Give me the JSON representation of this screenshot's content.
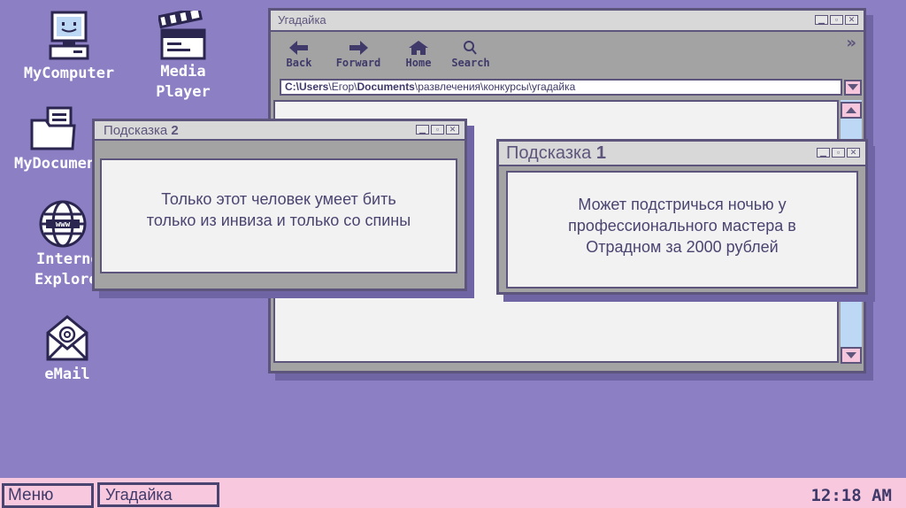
{
  "desktop": {
    "icons": [
      {
        "label": "MyComputer"
      },
      {
        "label_line1": "Media",
        "label_line2": "Player"
      },
      {
        "label": "MyDocuments"
      },
      {
        "label_line1": "Internet",
        "label_line2": "Explorer"
      },
      {
        "label": "eMail"
      }
    ]
  },
  "browser": {
    "title": "Угадайка",
    "toolbar": {
      "back_label": "Back",
      "forward_label": "Forward",
      "home_label": "Home",
      "search_label": "Search"
    },
    "more_glyph": "»",
    "address": {
      "drive": "C:\\",
      "seg_users": "Users",
      "sep1": "\\",
      "seg_user": "Егор",
      "sep2": "\\",
      "seg_documents": "Documents",
      "rest": "\\развлечения\\конкурсы\\угадайка"
    }
  },
  "hint2": {
    "title_word": "Подсказка",
    "title_num": "2",
    "text_line1": "Только этот человек умеет бить",
    "text_line2": "только из инвиза и только со спины"
  },
  "hint1": {
    "title_word": "Подсказка",
    "title_num": "1",
    "text_line1": "Может подстричься ночью у",
    "text_line2": "профессионального мастера в",
    "text_line3": "Отрадном за 2000 рублей"
  },
  "taskbar": {
    "start_label": "Меню",
    "task_label": "Угадайка",
    "clock": "12:18 AM"
  },
  "colors": {
    "desktop": "#8c7fc4",
    "window_frame": "#5e557c",
    "taskbar": "#f7c8de",
    "accent_pink": "#f5c6dc",
    "scroll_track": "#bcd8f4"
  }
}
